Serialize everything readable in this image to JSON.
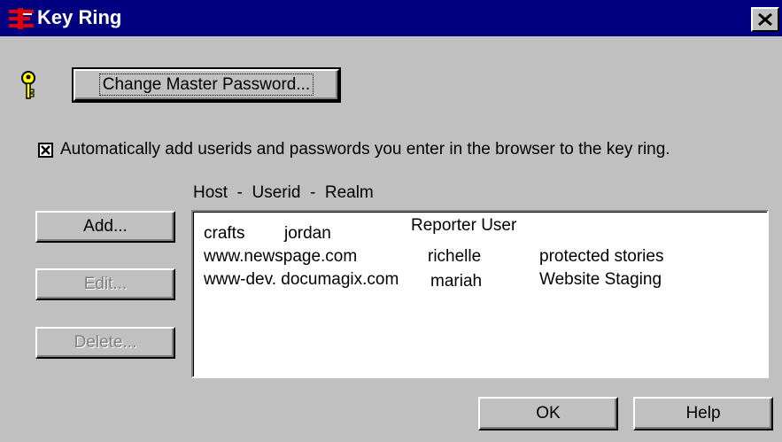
{
  "window": {
    "title": "Key Ring",
    "app_icon": "netscape-e-icon",
    "close_icon": "close-x-icon"
  },
  "master": {
    "icon": "key-icon",
    "change_button": "Change Master Password..."
  },
  "auto_add": {
    "checked": true,
    "label": "Automatically add userids and passwords you enter in the browser to the key ring."
  },
  "list": {
    "header": "Host  -  Userid  -  Realm",
    "rows": [
      {
        "host": "crafts",
        "userid": "jordan",
        "realm": "Reporter User"
      },
      {
        "host": "www.newspage.com",
        "userid": "richelle",
        "realm": "protected stories"
      },
      {
        "host": "www-dev. documagix.com",
        "userid": "mariah",
        "realm": "Website Staging"
      }
    ]
  },
  "buttons": {
    "add": "Add...",
    "edit": "Edit...",
    "delete": "Delete...",
    "ok": "OK",
    "help": "Help"
  },
  "colors": {
    "titlebar": "#000080",
    "face": "#c0c0c0",
    "key_yellow": "#ffff00",
    "brand_red": "#e00000"
  }
}
